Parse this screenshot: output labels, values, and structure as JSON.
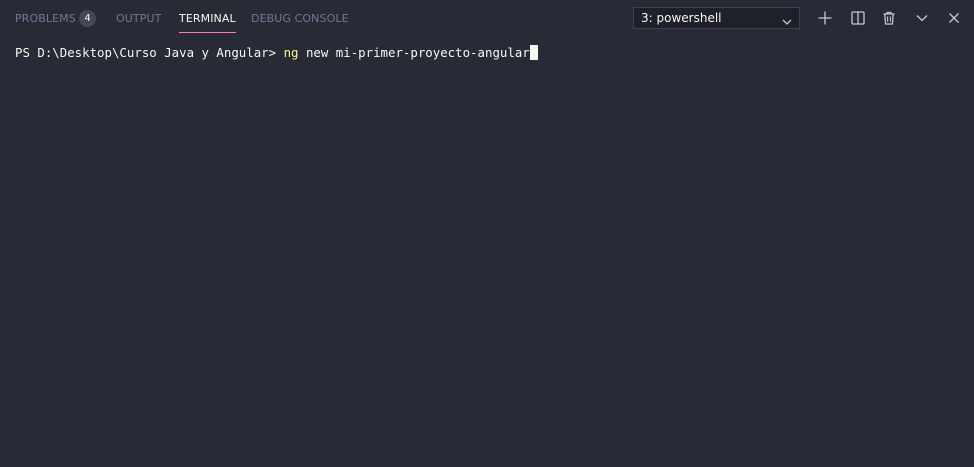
{
  "tabs": {
    "problems": {
      "label": "PROBLEMS",
      "badge": "4"
    },
    "output": {
      "label": "OUTPUT"
    },
    "terminal": {
      "label": "TERMINAL"
    },
    "debug_console": {
      "label": "DEBUG CONSOLE"
    }
  },
  "active_tab": "TERMINAL",
  "terminal_select": {
    "selected": "3: powershell",
    "icon": "chevron-down-icon"
  },
  "actions": [
    {
      "icon": "plus-icon"
    },
    {
      "icon": "split-terminal-icon"
    },
    {
      "icon": "trash-icon"
    },
    {
      "icon": "chevron-down-icon"
    },
    {
      "icon": "close-icon"
    }
  ],
  "terminal": {
    "prompt": "PS D:\\Desktop\\Curso Java y Angular> ",
    "command": "ng",
    "args": " new mi-primer-proyecto-angular"
  },
  "colors": {
    "background": "#282a36",
    "active_tab_underline": "#ff79c6",
    "command_highlight": "#f1fa8c",
    "inactive_tab_text": "#6f7a95",
    "text": "#f8f8f2"
  }
}
